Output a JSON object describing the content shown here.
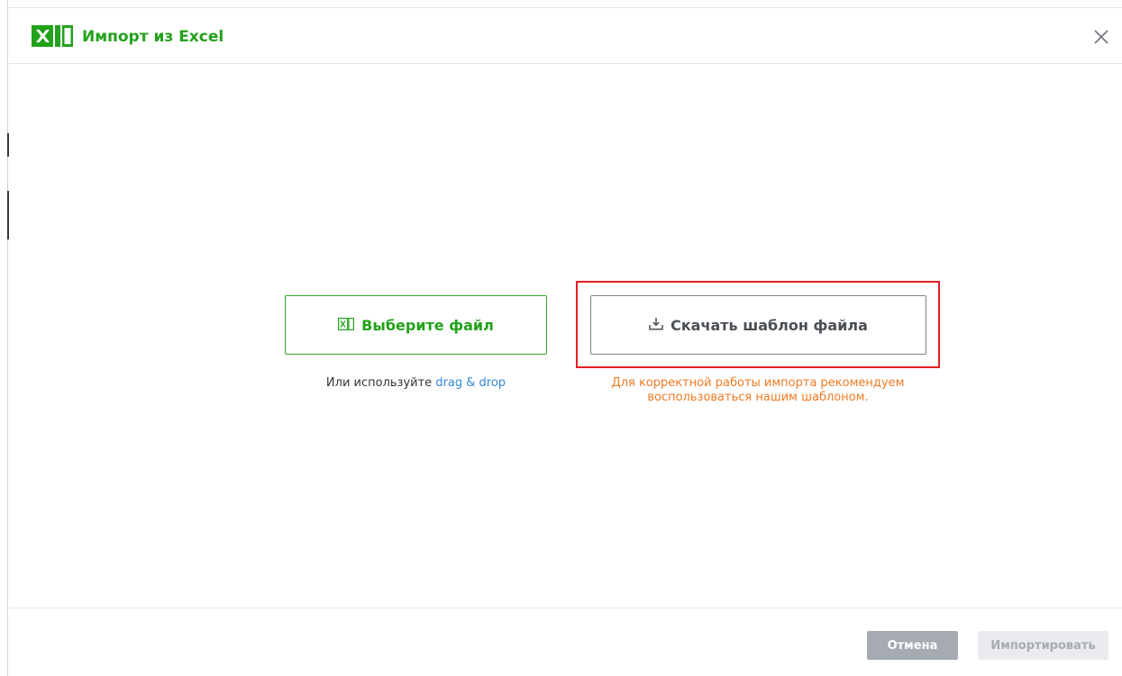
{
  "dialog": {
    "title": "Импорт из Excel",
    "close_icon": "close-icon",
    "logo_icon": "excel-logo-icon"
  },
  "upload": {
    "choose_label": "Выберите файл",
    "choose_icon": "excel-file-icon",
    "hint_prefix": "Или используйте ",
    "hint_link": "drag & drop"
  },
  "template": {
    "download_label": "Скачать шаблон файла",
    "download_icon": "download-icon",
    "note_line1": "Для корректной работы импорта рекомендуем",
    "note_line2": "воспользоваться нашим шаблоном."
  },
  "footer": {
    "cancel_label": "Отмена",
    "import_label": "Импортировать"
  },
  "colors": {
    "brand_green": "#22a21b",
    "note_orange": "#f07a22",
    "link_blue": "#2f86d6",
    "highlight_red": "#e31e24"
  }
}
